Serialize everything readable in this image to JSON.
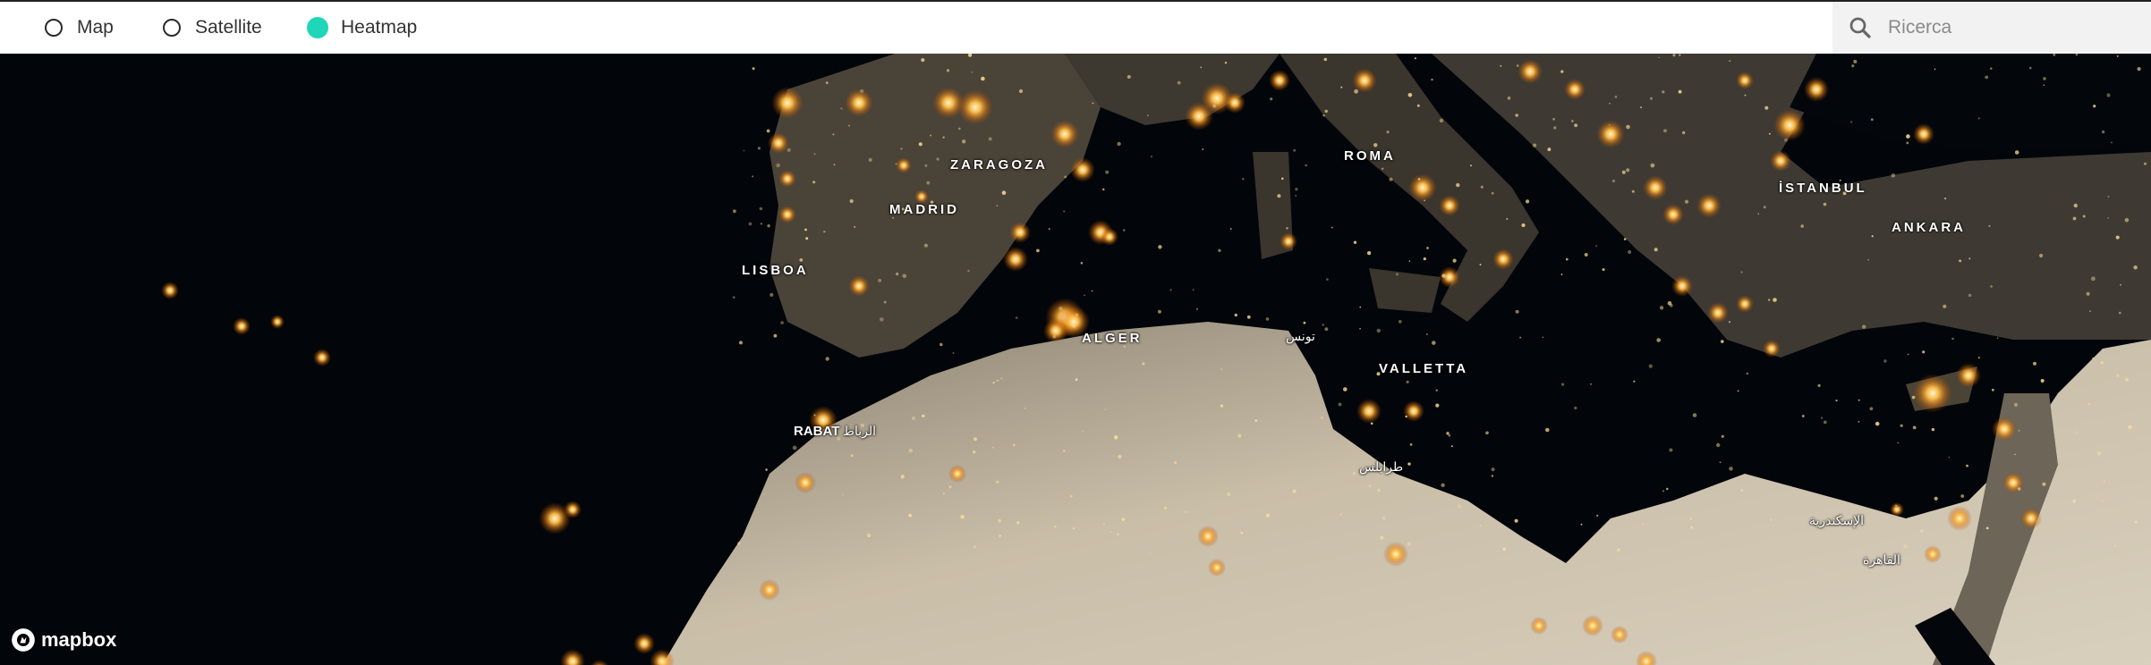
{
  "layers": [
    {
      "label": "Map",
      "selected": false
    },
    {
      "label": "Satellite",
      "selected": false
    },
    {
      "label": "Heatmap",
      "selected": true
    }
  ],
  "search": {
    "placeholder": "Ricerca",
    "value": ""
  },
  "map": {
    "cities": {
      "zaragoza": "ZARAGOZA",
      "madrid": "MADRID",
      "lisboa": "LISBOA",
      "roma": "ROMA",
      "istanbul": "İSTANBUL",
      "ankara": "ANKARA",
      "alger": "ALGER",
      "valletta": "VALLETTA",
      "rabat": "RABAT",
      "rabat_ar": "الرباط",
      "tunis_ar": "تونس",
      "tripoli_ar": "طرابلس",
      "alexandria_ar": "الإسكندرية",
      "cairo_ar": "القاهرة"
    },
    "attribution": "mapbox"
  },
  "colors": {
    "accent": "#1fd6b8",
    "glow": "#ffb347",
    "sea": "#03060a",
    "land": "#3f3a32",
    "desert": "#cfc4ae"
  }
}
